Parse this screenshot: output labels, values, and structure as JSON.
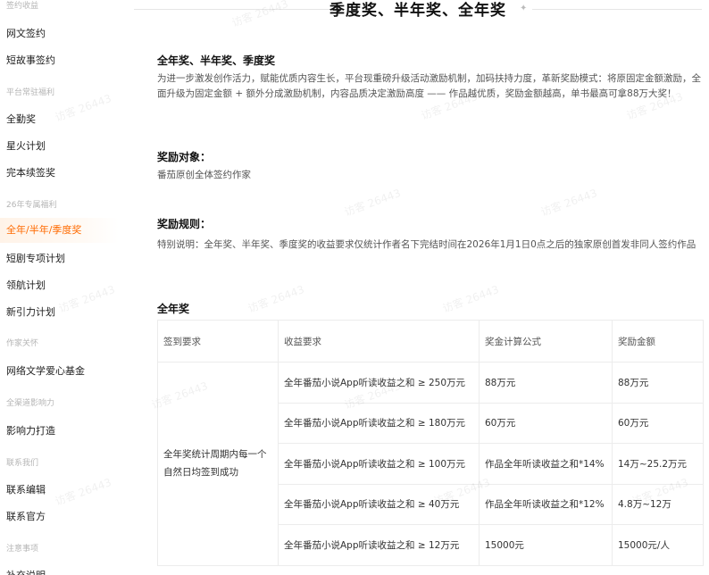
{
  "sidebar": {
    "sections": [
      {
        "label": "签约收益"
      },
      {
        "label": "平台常驻福利"
      },
      {
        "label": "26年专属福利"
      },
      {
        "label": "作家关怀"
      },
      {
        "label": "全渠道影响力"
      },
      {
        "label": "联系我们"
      },
      {
        "label": "注意事项"
      }
    ],
    "items": [
      {
        "label": "网文签约"
      },
      {
        "label": "短故事签约"
      },
      {
        "label": "全勤奖"
      },
      {
        "label": "星火计划"
      },
      {
        "label": "完本续签奖"
      },
      {
        "label": "全年/半年/季度奖",
        "active": true
      },
      {
        "label": "短剧专项计划"
      },
      {
        "label": "领航计划"
      },
      {
        "label": "新引力计划"
      },
      {
        "label": "网络文学爱心基金"
      },
      {
        "label": "影响力打造"
      },
      {
        "label": "联系编辑"
      },
      {
        "label": "联系官方"
      },
      {
        "label": "补充说明"
      }
    ],
    "active_color": "#ff6a00"
  },
  "main": {
    "title": "季度奖、半年奖、全年奖",
    "intro_heading": "全年奖、半年奖、季度奖",
    "intro_text": "为进一步激发创作活力，赋能优质内容生长，平台现重磅升级活动激励机制，加码扶持力度，革新奖励模式：将原固定金额激励，全面升级为固定金额 + 额外分成激励机制，内容品质决定激励高度 —— 作品越优质，奖励金额越高，单书最高可拿88万大奖！",
    "target_heading": "奖励对象：",
    "target_text": "番茄原创全体签约作家",
    "rules_heading": "奖励规则：",
    "rules_text": "特别说明：全年奖、半年奖、季度奖的收益要求仅统计作者名下完结时间在2026年1月1日0点之后的独家原创首发非同人签约作品",
    "annual_heading": "全年奖",
    "table": {
      "headers": [
        "签到要求",
        "收益要求",
        "奖金计算公式",
        "奖励金额"
      ],
      "signin_requirement": "全年奖统计周期内每一个自然日均签到成功",
      "rows": [
        {
          "revenue": "全年番茄小说App听读收益之和 ≥ 250万元",
          "formula": "88万元",
          "amount": "88万元"
        },
        {
          "revenue": "全年番茄小说App听读收益之和 ≥ 180万元",
          "formula": "60万元",
          "amount": "60万元"
        },
        {
          "revenue": "全年番茄小说App听读收益之和 ≥ 100万元",
          "formula": "作品全年听读收益之和*14%",
          "amount": "14万~25.2万元"
        },
        {
          "revenue": "全年番茄小说App听读收益之和 ≥ 40万元",
          "formula": "作品全年听读收益之和*12%",
          "amount": "4.8万~12万"
        },
        {
          "revenue": "全年番茄小说App听读收益之和 ≥ 12万元",
          "formula": "15000元",
          "amount": "15000元/人"
        }
      ]
    }
  },
  "watermark": "访客 26443"
}
